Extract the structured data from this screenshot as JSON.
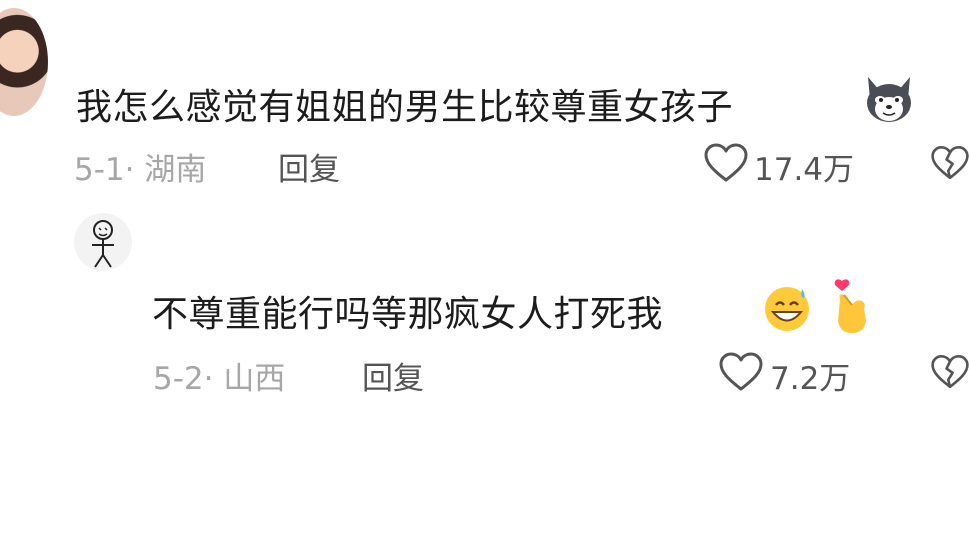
{
  "comments": [
    {
      "text": "我怎么感觉有姐姐的男生比较尊重女孩子",
      "meta": "5-1· 湖南",
      "reply_label": "回复",
      "likes": "17.4万"
    },
    {
      "text": "不尊重能行吗等那疯女人打死我",
      "meta": "5-2· 山西",
      "reply_label": "回复",
      "likes": "7.2万"
    }
  ],
  "icons": {
    "like": "heart-outline-icon",
    "dislike": "broken-heart-icon",
    "emoji1": "husky-dog-emoji",
    "emoji2": "grinning-sweat-emoji",
    "emoji3": "finger-heart-emoji"
  },
  "colors": {
    "text": "#1c1c1c",
    "meta": "#a7a7a7",
    "action": "#555555"
  }
}
